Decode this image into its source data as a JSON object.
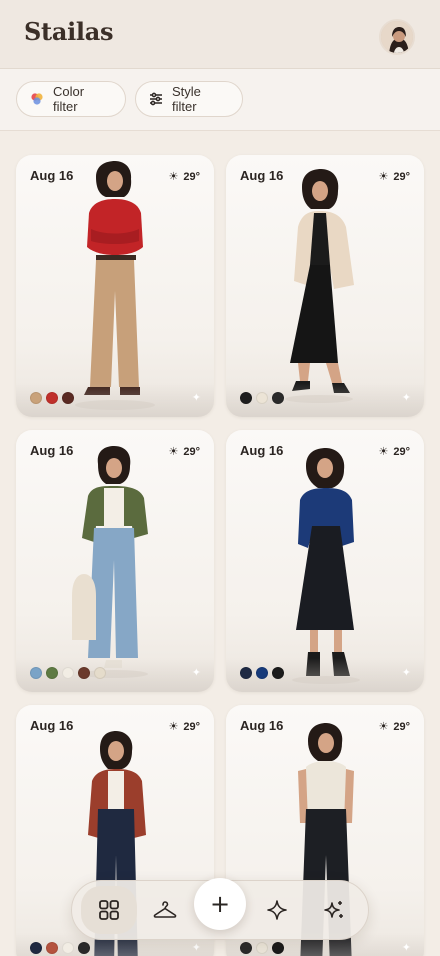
{
  "header": {
    "brand": "Stailas"
  },
  "filters": [
    {
      "label": "Color filter",
      "icon": "color-palette-icon"
    },
    {
      "label": "Style filter",
      "icon": "sliders-icon"
    }
  ],
  "outfits": [
    {
      "date": "Aug 16",
      "temp": "29°",
      "swatches": [
        "#c9a27a",
        "#c0302b",
        "#5a2a22"
      ]
    },
    {
      "date": "Aug 16",
      "temp": "29°",
      "swatches": [
        "#1e1e1e",
        "#ece4d6",
        "#2a2a2a"
      ]
    },
    {
      "date": "Aug 16",
      "temp": "29°",
      "swatches": [
        "#7aa3c7",
        "#5e7a43",
        "#f2ede4",
        "#6b3a2c",
        "#e5dccb"
      ]
    },
    {
      "date": "Aug 16",
      "temp": "29°",
      "swatches": [
        "#1f2a44",
        "#173a7a",
        "#1b1b1b"
      ]
    },
    {
      "date": "Aug 16",
      "temp": "29°",
      "swatches": [
        "#1f2940",
        "#b5533e",
        "#f2ede4",
        "#2a2a2a"
      ]
    },
    {
      "date": "Aug 16",
      "temp": "29°",
      "swatches": [
        "#2a2a2a",
        "#ece6da",
        "#1b1b1b"
      ]
    }
  ],
  "nav": {
    "items": [
      "grid-icon",
      "hanger-icon",
      "add-icon",
      "sparkle-icon",
      "sparkles-icon"
    ],
    "add_label": "+"
  }
}
